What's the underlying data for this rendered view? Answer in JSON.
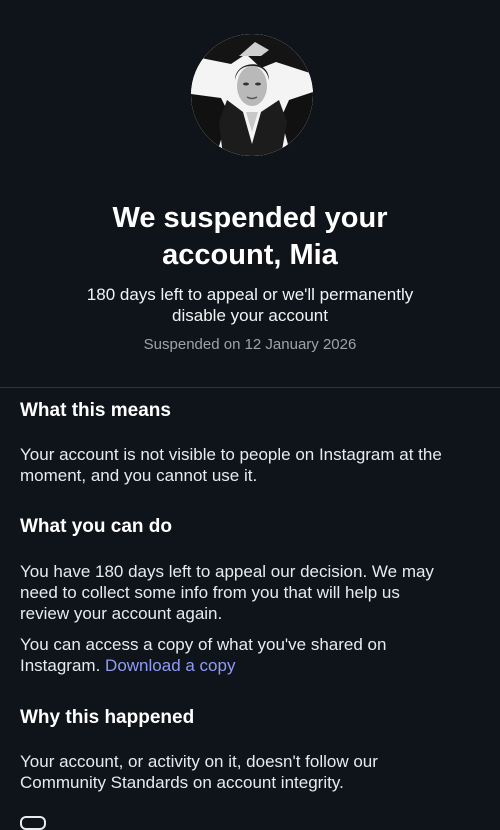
{
  "header": {
    "title_line1": "We suspended your",
    "title_line2": "account, Mia",
    "subtitle_line1": "180 days left to appeal or we'll permanently",
    "subtitle_line2": "disable your account",
    "suspended_date": "Suspended on 12 January 2026"
  },
  "sections": {
    "what_this_means": {
      "heading": "What this means",
      "line1": "Your account is not visible to people on Instagram at the",
      "line2": "moment, and you cannot use it."
    },
    "what_you_can_do": {
      "heading": "What you can do",
      "p1_line1": "You have 180 days left to appeal our decision. We may",
      "p1_line2": "need to collect some info from you that will help us",
      "p1_line3": "review your account again.",
      "p2_line1": "You can access a copy of what you've shared on",
      "p2_line2_text": "Instagram.",
      "download_link": "Download a copy"
    },
    "why_this_happened": {
      "heading": "Why this happened",
      "line1": "Your account, or activity on it, doesn't follow our",
      "line2": "Community Standards on account integrity."
    }
  },
  "colors": {
    "background": "#0f141a",
    "link": "#8f9bf5",
    "muted_text": "#9aa3ad",
    "divider": "#2c333b"
  }
}
